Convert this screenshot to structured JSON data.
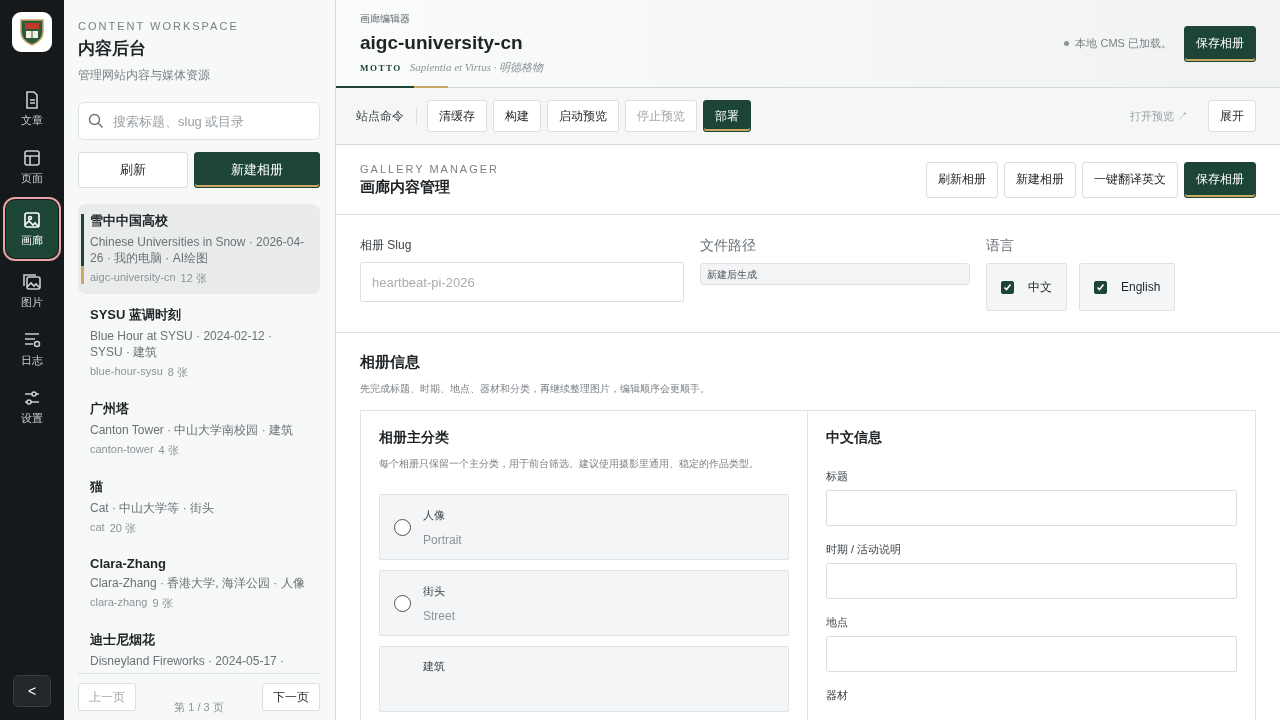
{
  "rail": {
    "items": [
      {
        "label": "文章",
        "selected": false
      },
      {
        "label": "页面",
        "selected": false
      },
      {
        "label": "画廊",
        "selected": true
      },
      {
        "label": "图片",
        "selected": false
      },
      {
        "label": "日志",
        "selected": false
      },
      {
        "label": "设置",
        "selected": false
      }
    ],
    "collapse": "<"
  },
  "sidebar": {
    "eyebrow": "CONTENT WORKSPACE",
    "title": "内容后台",
    "subtitle": "管理网站内容与媒体资源",
    "search": {
      "placeholder": "搜索标题、slug 或目录"
    },
    "buttons": [
      {
        "label": "刷新",
        "kind": "normal"
      },
      {
        "label": "新建相册",
        "kind": "primary"
      }
    ],
    "albums": [
      {
        "title": "雪中中国高校",
        "subtitle": "Chinese Universities in Snow · 2026-04-26 · 我的电脑 · AI绘图",
        "slug": "aigc-university-cn",
        "count": "12 张",
        "selected": true
      },
      {
        "title": "SYSU 蓝调时刻",
        "subtitle": "Blue Hour at SYSU · 2024-02-12 · SYSU · 建筑",
        "slug": "blue-hour-sysu",
        "count": "8 张",
        "selected": false
      },
      {
        "title": "广州塔",
        "subtitle": "Canton Tower · 中山大学南校园 · 建筑",
        "slug": "canton-tower",
        "count": "4 张",
        "selected": false
      },
      {
        "title": "猫",
        "subtitle": "Cat · 中山大学等 · 街头",
        "slug": "cat",
        "count": "20 张",
        "selected": false
      },
      {
        "title": "Clara-Zhang",
        "subtitle": "Clara-Zhang · 香港大学, 海洋公园 · 人像",
        "slug": "clara-zhang",
        "count": "9 张",
        "selected": false
      },
      {
        "title": "迪士尼烟花",
        "subtitle": "Disneyland Fireworks · 2024-05-17 ·",
        "selected": false
      }
    ],
    "pager": {
      "prev": {
        "label": "上一页",
        "disabled": true
      },
      "info": "第 1 / 3 页",
      "next": {
        "label": "下一页",
        "disabled": false
      }
    }
  },
  "header": {
    "eyebrow": "画廊编辑器",
    "title": "aigc-university-cn",
    "motto_label": "MOTTO",
    "motto": "Sapientia et Virtus · 明德格物",
    "status": "本地 CMS 已加载。",
    "save": "保存相册"
  },
  "commands": {
    "label": "站点命令",
    "buttons": [
      {
        "label": "清缓存",
        "kind": "normal",
        "disabled": false
      },
      {
        "label": "构建",
        "kind": "normal",
        "disabled": false
      },
      {
        "label": "启动预览",
        "kind": "normal",
        "disabled": false
      },
      {
        "label": "停止预览",
        "kind": "normal",
        "disabled": true
      },
      {
        "label": "部署",
        "kind": "primary",
        "disabled": false
      }
    ],
    "open_preview": {
      "label": "打开预览 ↗",
      "disabled": true
    },
    "expand": "展开"
  },
  "gallery": {
    "eyebrow": "GALLERY MANAGER",
    "title": "画廊内容管理",
    "buttons": [
      {
        "label": "刷新相册",
        "kind": "normal"
      },
      {
        "label": "新建相册",
        "kind": "normal"
      },
      {
        "label": "一键翻译英文",
        "kind": "normal"
      },
      {
        "label": "保存相册",
        "kind": "primary"
      }
    ]
  },
  "fields": {
    "slug": {
      "label": "相册 Slug",
      "placeholder": "heartbeat-pi-2026"
    },
    "path": {
      "label": "文件路径",
      "value": "新建后生成"
    },
    "language": {
      "label": "语言",
      "options": [
        {
          "label": "中文",
          "checked": true
        },
        {
          "label": "English",
          "checked": true
        }
      ]
    }
  },
  "album_info": {
    "title": "相册信息",
    "description": "先完成标题、时期、地点、器材和分类，再继续整理图片，编辑顺序会更顺手。",
    "category": {
      "title": "相册主分类",
      "description": "每个相册只保留一个主分类，用于前台筛选。建议使用摄影里通用、稳定的作品类型。",
      "options": [
        {
          "label": "人像",
          "english": "Portrait",
          "selected": false
        },
        {
          "label": "街头",
          "english": "Street",
          "selected": false
        },
        {
          "label": "建筑"
        }
      ]
    },
    "chinese": {
      "title": "中文信息",
      "fields": [
        {
          "label": "标题"
        },
        {
          "label": "时期 / 活动说明"
        },
        {
          "label": "地点"
        },
        {
          "label": "器材"
        }
      ]
    }
  }
}
